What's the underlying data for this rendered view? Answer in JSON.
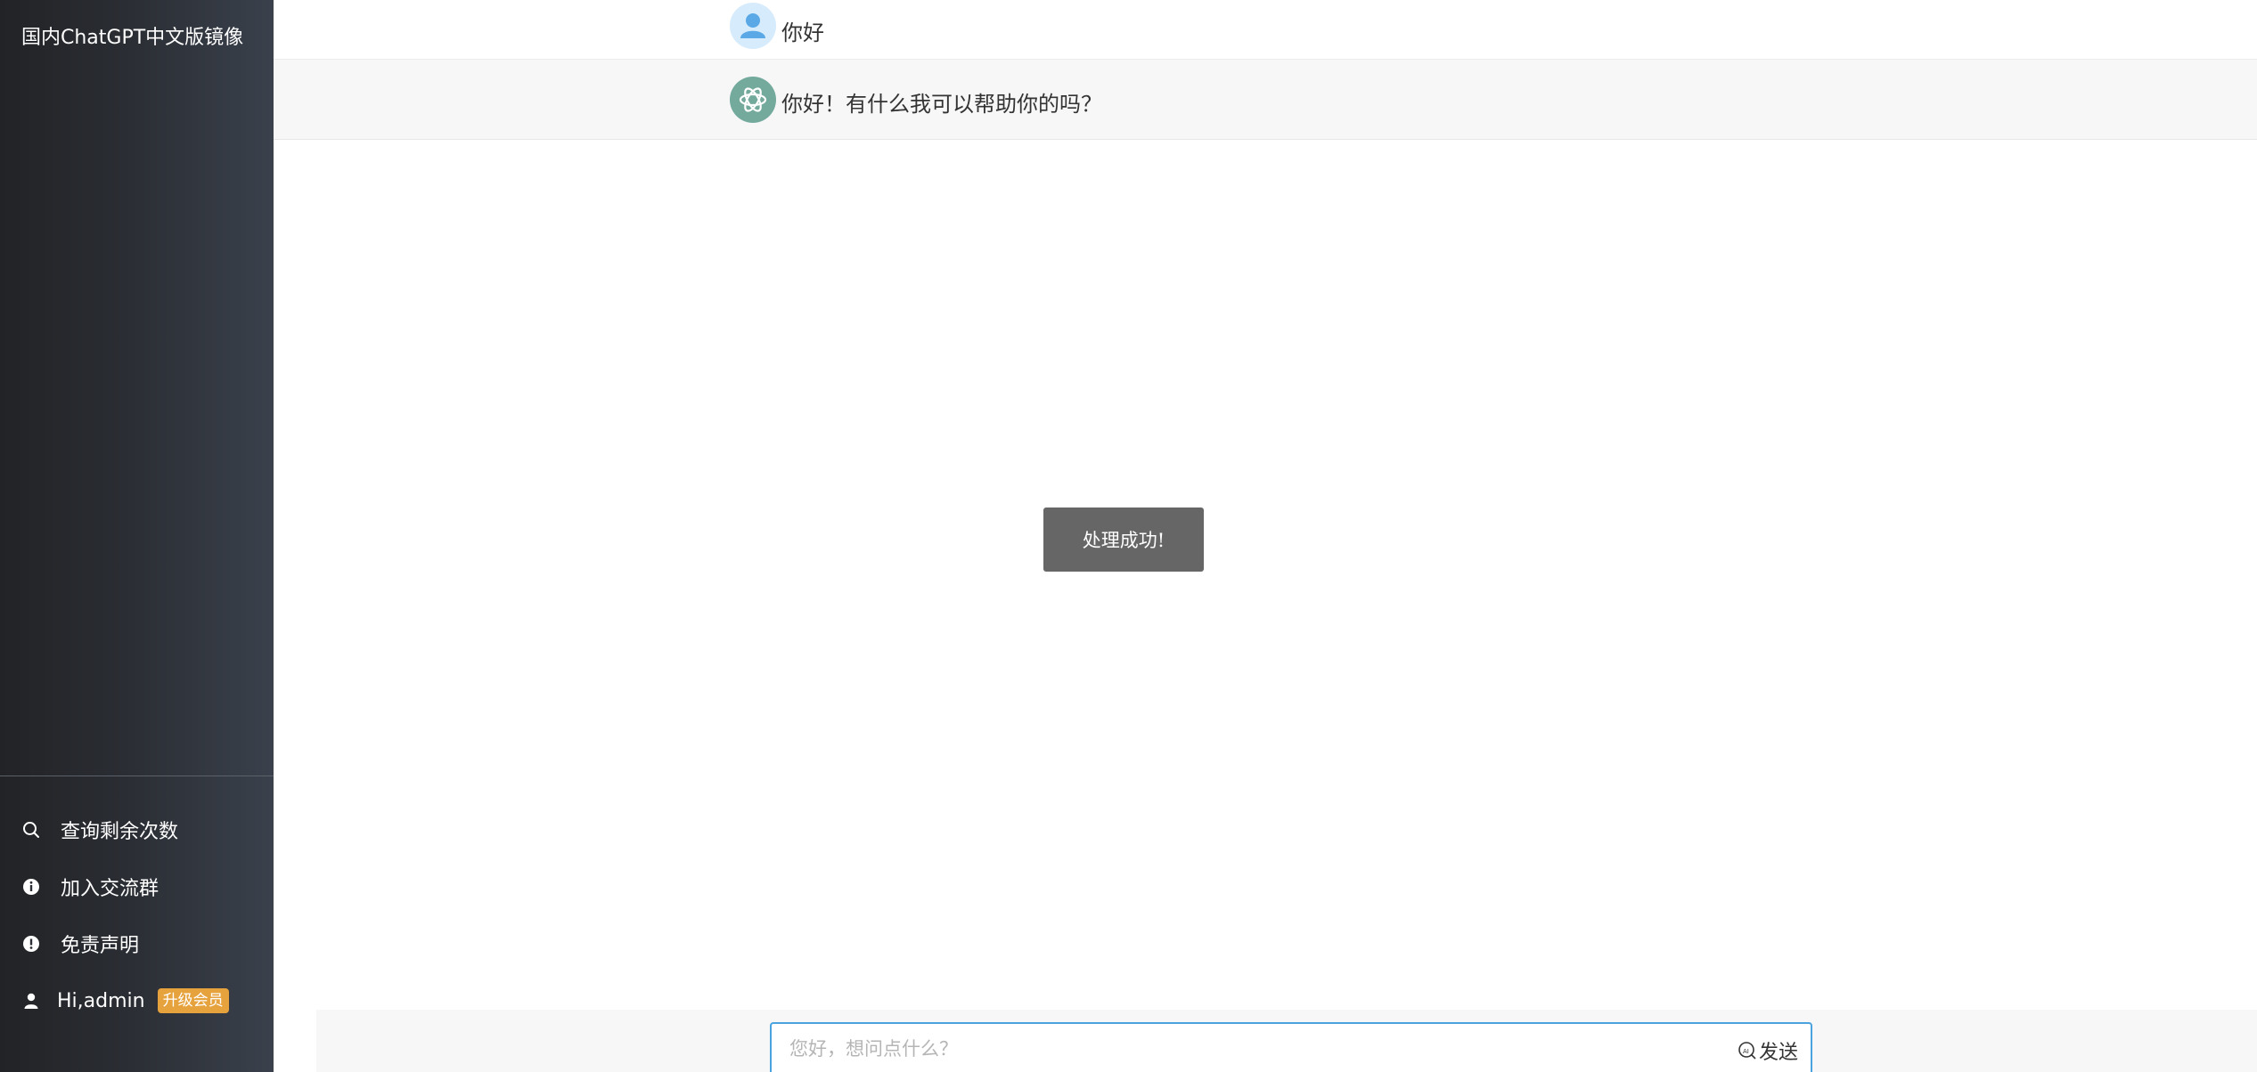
{
  "sidebar": {
    "brand": "国内ChatGPT中文版镜像",
    "menu": {
      "query": "查询剩余次数",
      "join_group": "加入交流群",
      "disclaimer": "免责声明",
      "user": "Hi,admin",
      "upgrade_badge": "升级会员"
    }
  },
  "chat": {
    "messages": [
      {
        "role": "user",
        "text": "你好"
      },
      {
        "role": "assistant",
        "text": "你好！有什么我可以帮助你的吗？"
      }
    ]
  },
  "toast": {
    "text": "处理成功!"
  },
  "composer": {
    "placeholder": "您好，想问点什么？",
    "send_label": "发送"
  },
  "colors": {
    "sidebar_dark": "#222326",
    "sidebar_light": "#3a414c",
    "badge": "#e6a23c",
    "bot_avatar": "#74aa9c",
    "input_border": "#4aa3df",
    "toast_bg": "#666666"
  }
}
